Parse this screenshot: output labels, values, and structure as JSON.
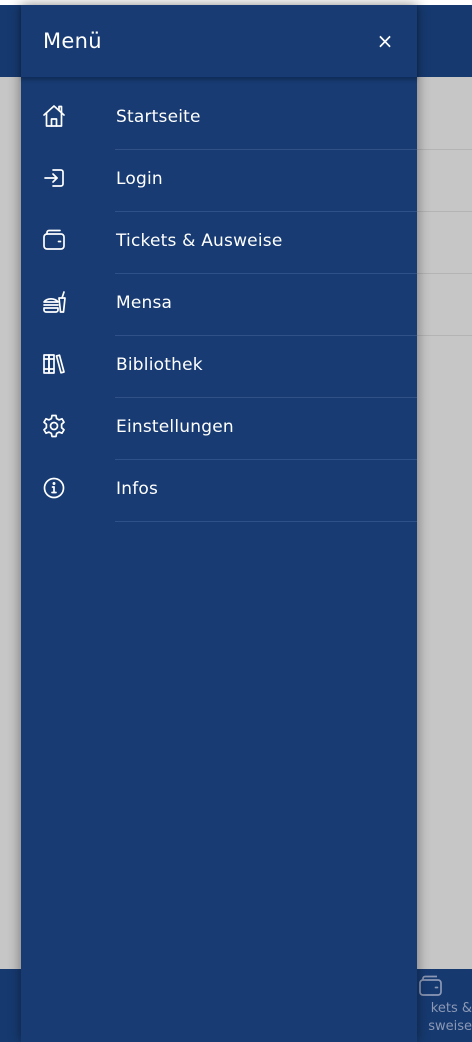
{
  "drawer": {
    "title": "Menü",
    "close_label": "×",
    "items": [
      {
        "label": "Startseite",
        "icon": "home-icon"
      },
      {
        "label": "Login",
        "icon": "login-icon"
      },
      {
        "label": "Tickets & Ausweise",
        "icon": "wallet-icon"
      },
      {
        "label": "Mensa",
        "icon": "food-icon"
      },
      {
        "label": "Bibliothek",
        "icon": "library-icon"
      },
      {
        "label": "Einstellungen",
        "icon": "gear-icon"
      },
      {
        "label": "Infos",
        "icon": "info-icon"
      }
    ]
  },
  "bottom_bar": {
    "tickets_label": "kets &\nsweise"
  },
  "colors": {
    "primary": "#173b72",
    "overlay": "#c6c6c6",
    "text": "#ffffff"
  }
}
